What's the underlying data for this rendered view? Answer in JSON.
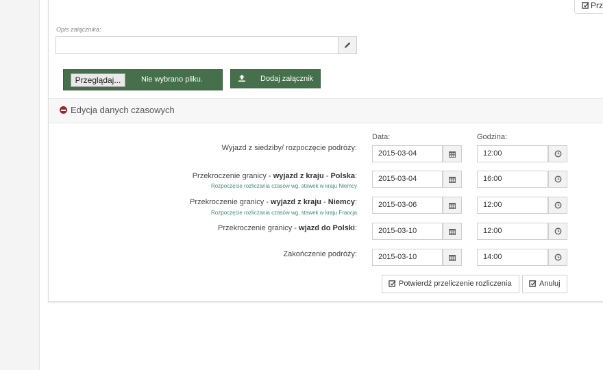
{
  "top_right_button": {
    "label": "Prz"
  },
  "attachment": {
    "description_label": "Opis załącznika:",
    "description_value": "",
    "browse_label": "Przeglądaj...",
    "no_file_text": "Nie wybrano pliku.",
    "add_label": "Dodaj załącznik"
  },
  "time_section": {
    "title": "Edycja danych czasowych",
    "date_header": "Data:",
    "time_header": "Godzina:",
    "rows": [
      {
        "label_parts": [
          "Wyjazd z siedziby/ rozpoczęcie podróży:"
        ],
        "sub": "",
        "date": "2015-03-04",
        "time": "12:00"
      },
      {
        "label_parts": [
          "Przekroczenie granicy - ",
          "wyjazd z kraju",
          " - ",
          "Polska",
          ":"
        ],
        "sub": "Rozpoczęcie rozliczania czasów wg. stawek w kraju Niemcy",
        "date": "2015-03-04",
        "time": "16:00"
      },
      {
        "label_parts": [
          "Przekroczenie granicy - ",
          "wyjazd z kraju",
          " - ",
          "Niemcy",
          ":"
        ],
        "sub": "Rozpoczęcie rozliczania czasów wg. stawek w kraju Francja",
        "date": "2015-03-06",
        "time": "12:00"
      },
      {
        "label_parts": [
          "Przekroczenie granicy - ",
          "wjazd do Polski",
          ":"
        ],
        "sub": "",
        "date": "2015-03-10",
        "time": "12:00"
      },
      {
        "label_parts": [
          "Zakończenie podróży:"
        ],
        "sub": "",
        "date": "2015-03-10",
        "time": "14:00"
      }
    ],
    "confirm_label": "Potwierdź przeliczenie rozliczenia",
    "cancel_label": "Anuluj"
  },
  "icons": {
    "edit": "pencil-icon",
    "upload": "upload-icon",
    "collapse": "minus-circle-icon",
    "calendar": "calendar-icon",
    "clock": "clock-icon",
    "confirm": "check-square-icon"
  },
  "colors": {
    "primary_green": "#46704b",
    "collapse_red": "#a0242c",
    "sub_teal": "#3f8a7a"
  }
}
